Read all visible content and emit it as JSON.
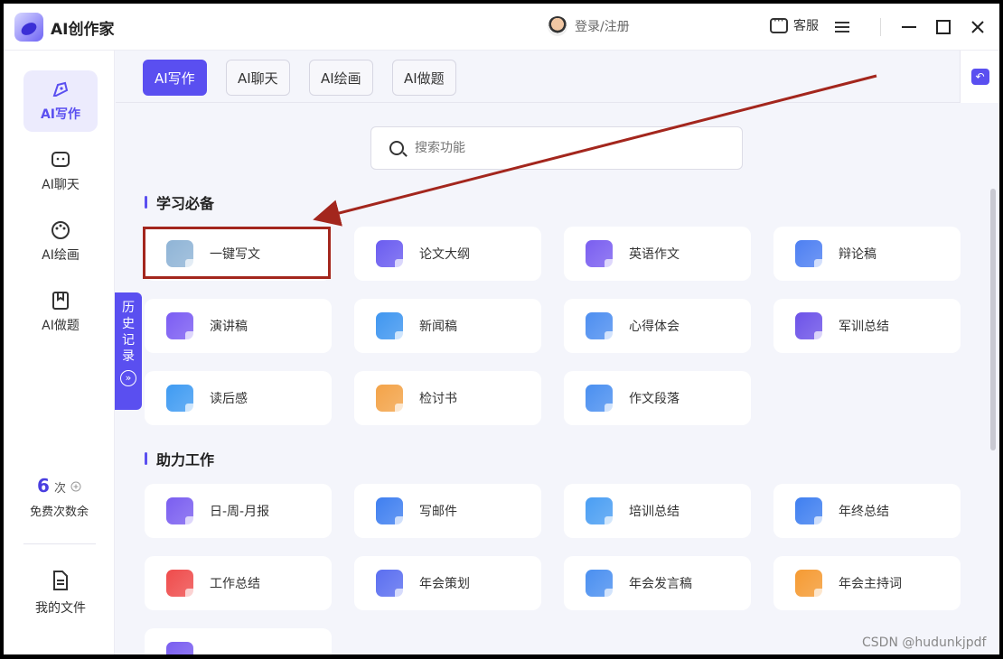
{
  "app": {
    "title": "AI创作家"
  },
  "header": {
    "login_label": "登录/注册",
    "service_label": "客服"
  },
  "nav": {
    "items": [
      {
        "label": "AI写作",
        "active": true
      },
      {
        "label": "AI聊天"
      },
      {
        "label": "AI绘画"
      },
      {
        "label": "AI做题"
      }
    ],
    "credits_count": "6",
    "credits_unit": "次",
    "credits_label": "免费次数余",
    "my_files_label": "我的文件"
  },
  "history_tab": {
    "chars": [
      "历",
      "史",
      "记",
      "录"
    ],
    "expand_glyph": "»"
  },
  "tabs": [
    "AI写作",
    "AI聊天",
    "AI绘画",
    "AI做题"
  ],
  "search": {
    "placeholder": "搜索功能"
  },
  "sections": [
    {
      "title": "学习必备",
      "cards": [
        {
          "label": "一键写文",
          "icon": "image-icon",
          "color": "#8fb4d6"
        },
        {
          "label": "论文大纲",
          "icon": "image-icon",
          "color": "#6a5cf0"
        },
        {
          "label": "英语作文",
          "icon": "image-icon",
          "color": "#7a5ef0"
        },
        {
          "label": "辩论稿",
          "icon": "face-icon",
          "color": "#4d7ff2"
        },
        {
          "label": "演讲稿",
          "icon": "bars-icon",
          "color": "#7b5cf3"
        },
        {
          "label": "新闻稿",
          "icon": "play-icon",
          "color": "#3f96f0"
        },
        {
          "label": "心得体会",
          "icon": "text-icon",
          "color": "#4d8ef0"
        },
        {
          "label": "军训总结",
          "icon": "image-icon",
          "color": "#6c52e8"
        },
        {
          "label": "读后感",
          "icon": "play-icon",
          "color": "#3f9bf2"
        },
        {
          "label": "检讨书",
          "icon": "doc-icon",
          "color": "#f3a348"
        },
        {
          "label": "作文段落",
          "icon": "list-icon",
          "color": "#4a8ff0"
        }
      ]
    },
    {
      "title": "助力工作",
      "cards": [
        {
          "label": "日-周-月报",
          "icon": "image-icon",
          "color": "#7a5ef0"
        },
        {
          "label": "写邮件",
          "icon": "text-icon",
          "color": "#3f7ff0"
        },
        {
          "label": "培训总结",
          "icon": "bars-icon",
          "color": "#4a9ef3"
        },
        {
          "label": "年终总结",
          "icon": "play-icon",
          "color": "#3f7ff0"
        },
        {
          "label": "工作总结",
          "icon": "pdf-icon",
          "color": "#ef4b4b"
        },
        {
          "label": "年会策划",
          "icon": "w-icon",
          "color": "#5a6ef0"
        },
        {
          "label": "年会发言稿",
          "icon": "table-icon",
          "color": "#4a8ff0"
        },
        {
          "label": "年会主持词",
          "icon": "p-icon",
          "color": "#f59a32"
        },
        {
          "label": "",
          "icon": "image-icon",
          "color": "#7a5ef0"
        }
      ]
    }
  ],
  "watermark": "CSDN @hudunkjpdf",
  "colors": {
    "accent": "#5a4ff0",
    "highlight": "#a3261d"
  }
}
